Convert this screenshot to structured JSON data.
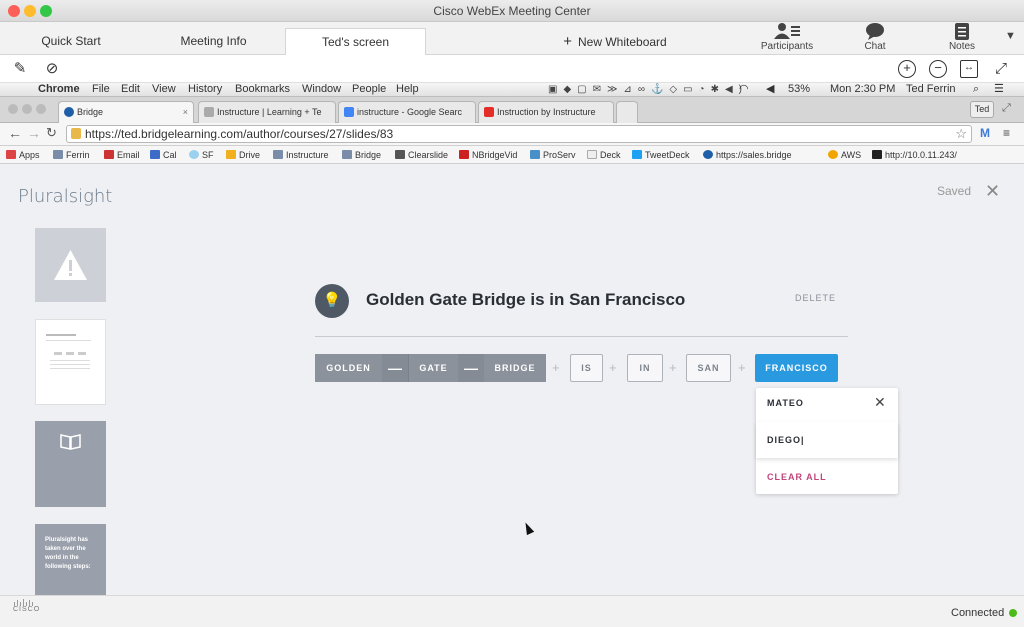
{
  "webex": {
    "title": "Cisco WebEx Meeting Center",
    "tabs": [
      "Quick Start",
      "Meeting Info",
      "Ted's screen"
    ],
    "new_whiteboard": "New Whiteboard",
    "participants": "Participants",
    "chat": "Chat",
    "notes": "Notes",
    "status": "Connected",
    "cisco_logo": "CISCO"
  },
  "mac_menu": {
    "app": "Chrome",
    "items": [
      "File",
      "Edit",
      "View",
      "History",
      "Bookmarks",
      "Window",
      "People",
      "Help"
    ],
    "battery": "53%",
    "clock": "Mon 2:30 PM",
    "user": "Ted Ferrin"
  },
  "chrome": {
    "tabs": [
      "Bridge",
      "Instructure | Learning + Te",
      "instructure - Google Searc",
      "Instruction by Instructure"
    ],
    "profile": "Ted",
    "url": "https://ted.bridgelearning.com/author/courses/27/slides/83",
    "bookmarks": [
      "Apps",
      "Ferrin",
      "Email",
      "Cal",
      "SF",
      "Drive",
      "Instructure",
      "Bridge",
      "Clearslide",
      "NBridgeVid",
      "ProServ",
      "Deck",
      "TweetDeck",
      "https://sales.bridge",
      "AWS",
      "http://10.0.11.243/"
    ]
  },
  "page": {
    "brand": "Pluralsight",
    "saved": "Saved",
    "heading": "Golden Gate Bridge is in San Francisco",
    "delete": "DELETE",
    "thumb4_text": "Pluralsight has taken over the world in the following steps:",
    "chips": [
      "GOLDEN",
      "GATE",
      "BRIDGE",
      "IS",
      "IN",
      "SAN",
      "FRANCISCO"
    ],
    "joiner": "—",
    "dropdown": {
      "item1": "MATEO",
      "input": "DIEGO|",
      "clear": "CLEAR ALL"
    }
  },
  "colors": {
    "accent": "#2a9ae0",
    "chip_dark": "#8c929c",
    "clear_all": "#c0457a",
    "status_green": "#4cbb17"
  }
}
